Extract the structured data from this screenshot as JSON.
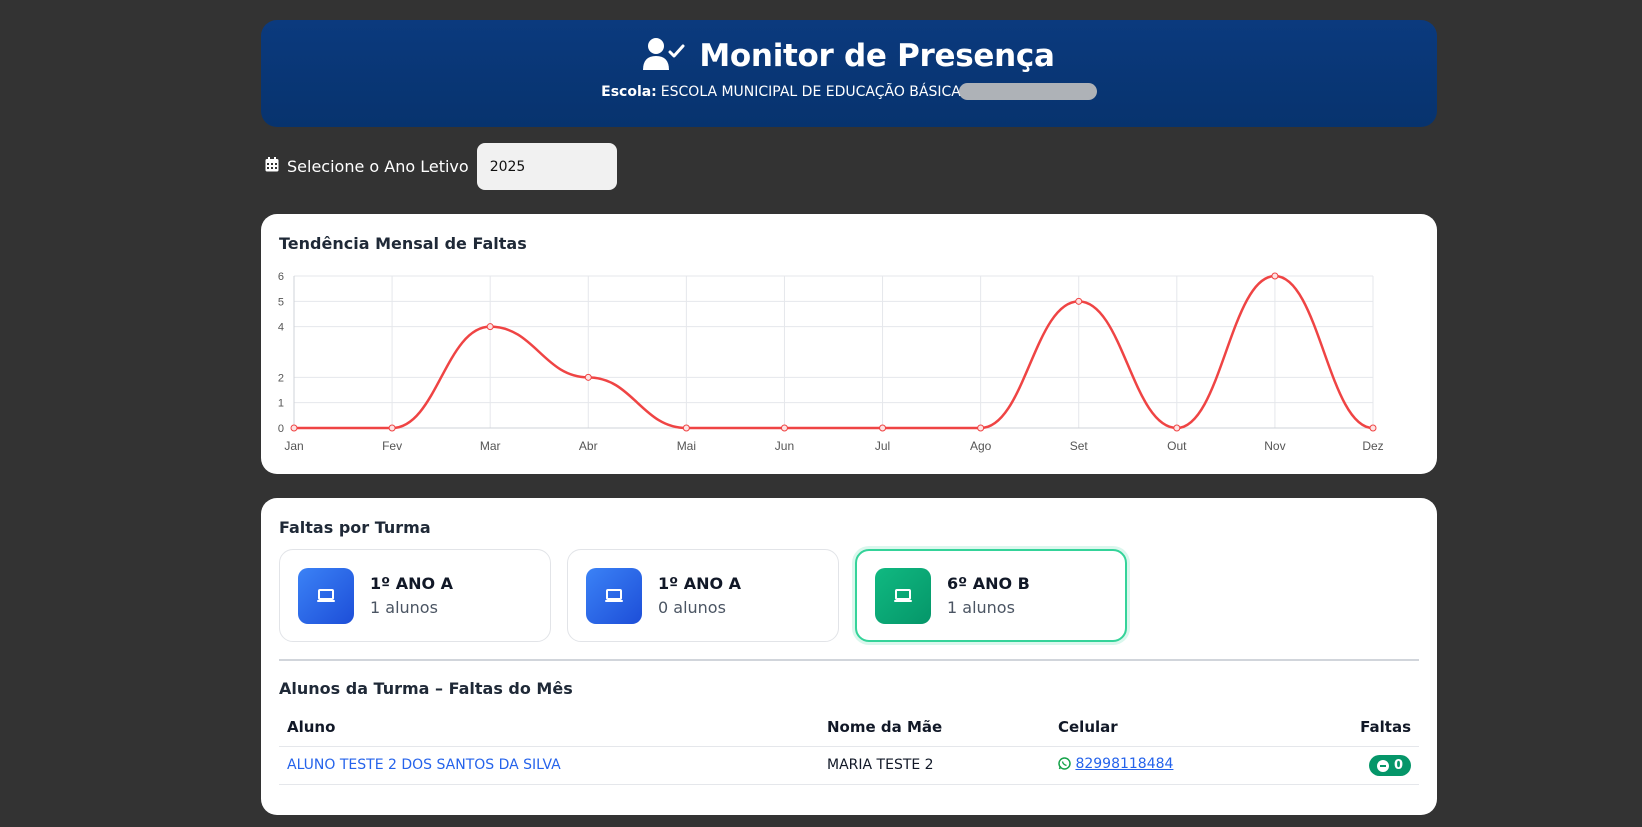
{
  "header": {
    "title": "Monitor de Presença",
    "school_label": "Escola:",
    "school_name": "ESCOLA MUNICIPAL DE EDUCAÇÃO BÁSICA",
    "icon": "user-check-icon"
  },
  "year_selector": {
    "label": "Selecione o Ano Letivo",
    "value": "2025",
    "icon": "calendar-icon"
  },
  "trend": {
    "title": "Tendência Mensal de Faltas"
  },
  "chart_data": {
    "type": "line",
    "categories": [
      "Jan",
      "Fev",
      "Mar",
      "Abr",
      "Mai",
      "Jun",
      "Jul",
      "Ago",
      "Set",
      "Out",
      "Nov",
      "Dez"
    ],
    "values": [
      0,
      0,
      4,
      2,
      0,
      0,
      0,
      0,
      5,
      0,
      6,
      0
    ],
    "ylim": [
      0,
      6
    ],
    "yticks": [
      "0",
      "1",
      "2",
      "4",
      "5",
      "6"
    ],
    "grid": true,
    "color": "#ef4444"
  },
  "turmas": {
    "title": "Faltas por Turma",
    "items": [
      {
        "name": "1º ANO A",
        "count": "1 alunos",
        "color": "blue",
        "active": false
      },
      {
        "name": "1º ANO A",
        "count": "0 alunos",
        "color": "blue",
        "active": false
      },
      {
        "name": "6º ANO B",
        "count": "1 alunos",
        "color": "green",
        "active": true
      }
    ]
  },
  "students": {
    "title": "Alunos da Turma – Faltas do Mês",
    "headers": {
      "aluno": "Aluno",
      "mae": "Nome da Mãe",
      "celular": "Celular",
      "faltas": "Faltas"
    },
    "rows": [
      {
        "aluno": "ALUNO TESTE 2 DOS SANTOS DA SILVA",
        "mae": "MARIA TESTE 2",
        "celular": "82998118484",
        "faltas": "0"
      }
    ]
  }
}
